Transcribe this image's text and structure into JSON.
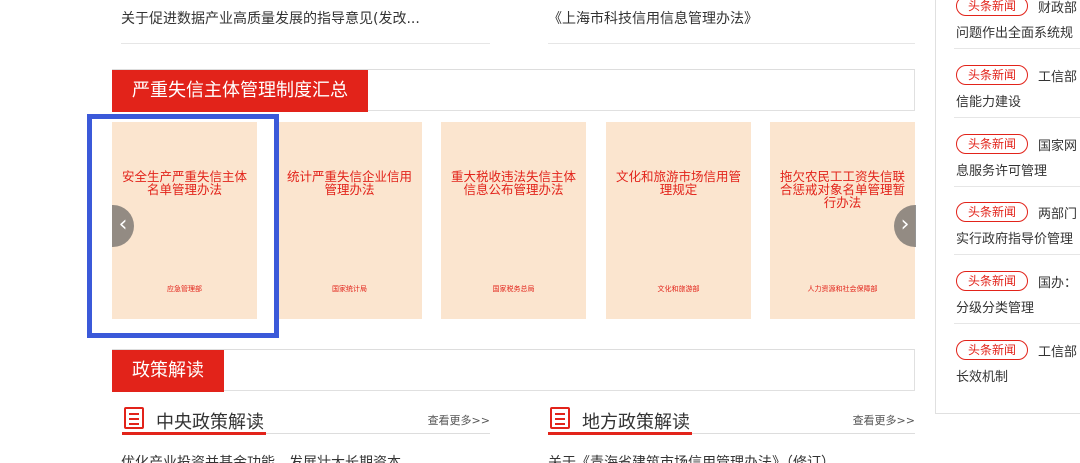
{
  "top_links": [
    "关于促进数据产业高质量发展的指导意见(发改...",
    "《上海市科技信用信息管理办法》"
  ],
  "section_main": {
    "title": "严重失信主体管理制度汇总",
    "cards": [
      {
        "title": "安全生产严重失信主体名单管理办法",
        "issuer": "应急管理部"
      },
      {
        "title": "统计严重失信企业信用管理办法",
        "issuer": "国家统计局"
      },
      {
        "title": "重大税收违法失信主体信息公布管理办法",
        "issuer": "国家税务总局"
      },
      {
        "title": "文化和旅游市场信用管理规定",
        "issuer": "文化和旅游部"
      },
      {
        "title": "拖欠农民工工资失信联合惩戒对象名单管理暂行办法",
        "issuer": "人力资源和社会保障部"
      }
    ]
  },
  "section_policy": {
    "title": "政策解读",
    "central": {
      "title": "中央政策解读",
      "more": "查看更多>>",
      "first_item": "优化产业投资并基金功能，发展壮大长期资本"
    },
    "local": {
      "title": "地方政策解读",
      "more": "查看更多>>",
      "first_item": "关于《青海省建筑市场信用管理办法》（修订）"
    }
  },
  "news_panel": {
    "items": [
      {
        "tag": "头条新闻",
        "org": "财政部",
        "line2": "问题作出全面系统规"
      },
      {
        "tag": "头条新闻",
        "org": "工信部",
        "line2": "信能力建设"
      },
      {
        "tag": "头条新闻",
        "org": "国家网",
        "line2": "息服务许可管理"
      },
      {
        "tag": "头条新闻",
        "org": "两部门",
        "line2": "实行政府指导价管理"
      },
      {
        "tag": "头条新闻",
        "org": "国办：",
        "line2": "分级分类管理"
      },
      {
        "tag": "头条新闻",
        "org": "工信部",
        "line2": "长效机制"
      }
    ]
  },
  "icons": {
    "prev": "chevron-left-icon",
    "next": "chevron-right-icon",
    "list": "list-icon"
  },
  "colors": {
    "accent": "#e2231a",
    "card_bg": "#fbe5cf",
    "highlight": "#3b59d9"
  }
}
